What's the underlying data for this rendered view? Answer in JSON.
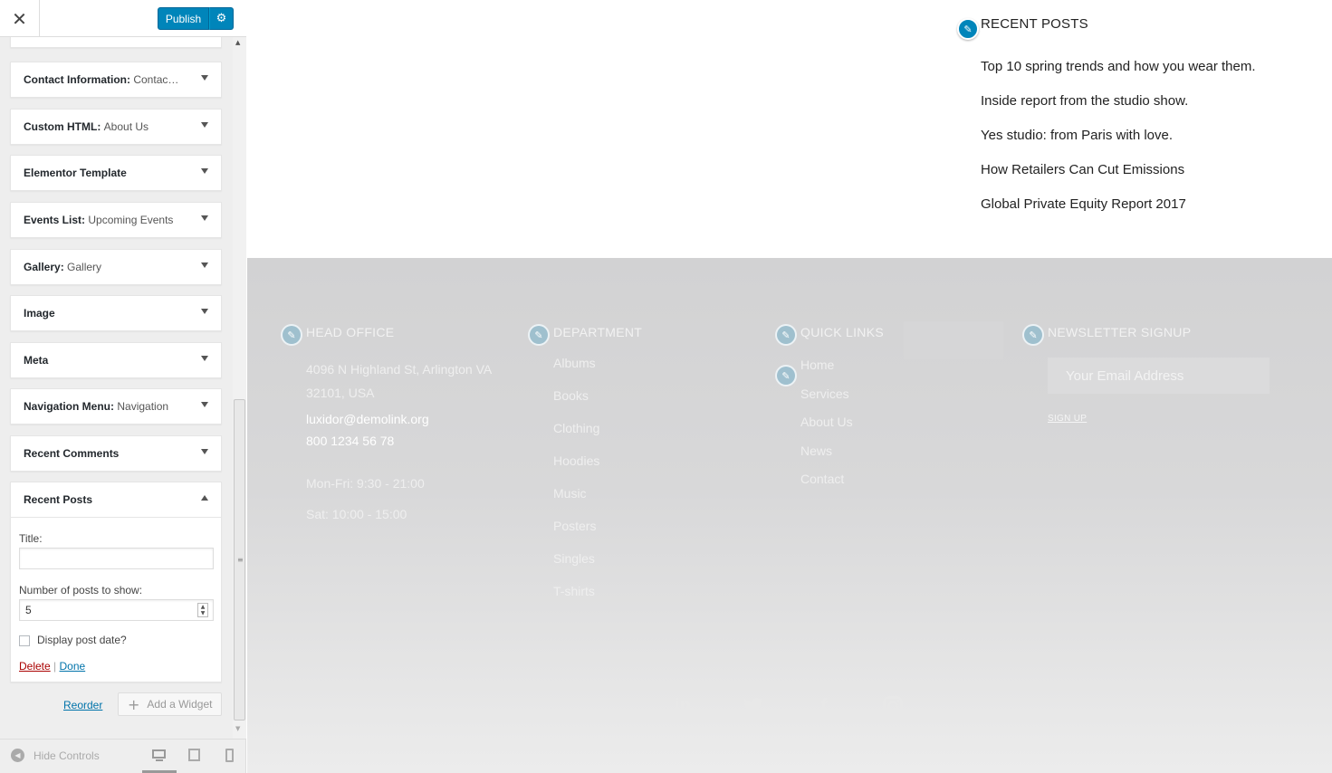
{
  "sidebar": {
    "publish_label": "Publish",
    "widgets": [
      {
        "name": "Contact Information:",
        "sub": "Contac…"
      },
      {
        "name": "Custom HTML:",
        "sub": "About Us"
      },
      {
        "name": "Elementor Template",
        "sub": ""
      },
      {
        "name": "Events List:",
        "sub": "Upcoming Events"
      },
      {
        "name": "Gallery:",
        "sub": "Gallery"
      },
      {
        "name": "Image",
        "sub": ""
      },
      {
        "name": "Meta",
        "sub": ""
      },
      {
        "name": "Navigation Menu:",
        "sub": "Navigation"
      },
      {
        "name": "Recent Comments",
        "sub": ""
      }
    ],
    "open_widget": {
      "name": "Recent Posts",
      "title_label": "Title:",
      "title_value": "",
      "count_label": "Number of posts to show:",
      "count_value": "5",
      "date_label": "Display post date?",
      "date_checked": false,
      "delete_label": "Delete",
      "separator": "|",
      "done_label": "Done"
    },
    "reorder_label": "Reorder",
    "add_widget_label": "Add a Widget",
    "hide_controls_label": "Hide Controls"
  },
  "preview": {
    "recent_posts": {
      "title": "RECENT POSTS",
      "items": [
        "Top 10 spring trends and how you wear them.",
        "Inside report from the studio show.",
        "Yes studio: from Paris with love.",
        "How Retailers Can Cut Emissions",
        "Global Private Equity Report 2017"
      ]
    },
    "footer": {
      "head_office": {
        "title": "HEAD OFFICE",
        "address": "4096 N Highland St, Arlington VA 32101, USA",
        "email": "luxidor@demolink.org",
        "phone": "800 1234 56 78",
        "hours_weekday": "Mon-Fri: 9:30 - 21:00",
        "hours_sat": "Sat: 10:00 - 15:00"
      },
      "department": {
        "title": "DEPARTMENT",
        "links": [
          "Albums",
          "Books",
          "Clothing",
          "Hoodies",
          "Music",
          "Posters",
          "Singles",
          "T-shirts"
        ]
      },
      "quick_links": {
        "title": "QUICK LINKS",
        "links": [
          "Home",
          "Services",
          "About Us",
          "News",
          "Contact"
        ]
      },
      "newsletter": {
        "title": "NEWSLETTER SIGNUP",
        "placeholder": "Your Email Address",
        "signup_label": "SIGN UP"
      },
      "social": [
        "linkedin-icon",
        "twitter-icon",
        "facebook-icon",
        "instagram-icon"
      ]
    }
  },
  "colors": {
    "accent": "#0085ba",
    "link": "#0073aa",
    "delete": "#aa0000",
    "footer_bg": "#d2d2d3"
  }
}
